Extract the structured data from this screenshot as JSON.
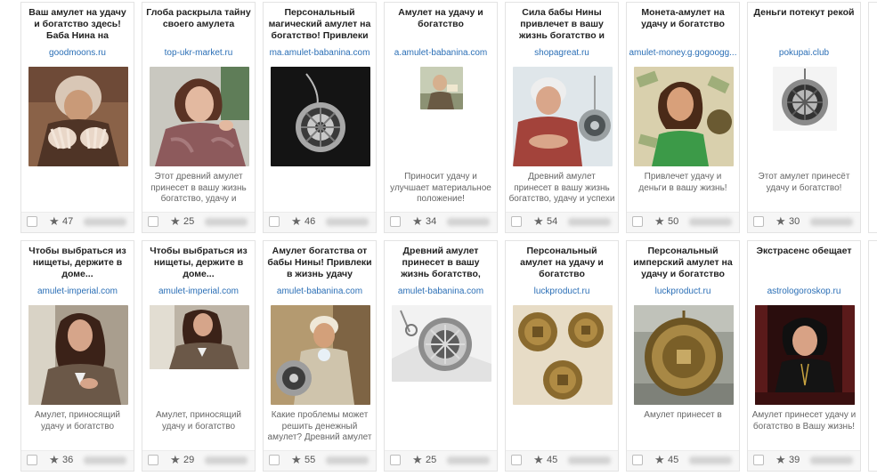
{
  "cards": [
    {
      "title": "Ваш амулет на удачу и богатство здесь! Баба Нина на рассвете",
      "domain": "goodmoons.ru",
      "description": "",
      "rating": "47",
      "image": "woman-hands-photo"
    },
    {
      "title": "Глоба раскрыла тайну своего амулета",
      "domain": "top-ukr-market.ru",
      "description": "Этот древний амулет принесет в вашу жизнь богатство, удачу и",
      "rating": "25",
      "image": "actress-photo"
    },
    {
      "title": "Персональный магический амулет на богатство! Привлеки в",
      "domain": "ma.amulet-babanina.com",
      "description": "",
      "rating": "46",
      "image": "amulet-dark-photo"
    },
    {
      "title": "Амулет на удачу и богатство",
      "domain": "a.amulet-babanina.com",
      "description": "Приносит удачу и улучшает материальное положение!",
      "rating": "34",
      "image": "small-man-photo"
    },
    {
      "title": "Сила бабы Нины привлечет в вашу жизнь богатство и",
      "domain": "shopagreat.ru",
      "description": "Древний амулет принесет в вашу жизнь богатство, удачу и успехи в любых",
      "rating": "54",
      "image": "old-woman-amulet-photo"
    },
    {
      "title": "Монета-амулет на удачу и богатство",
      "domain": "amulet-money.g.gogoogg...",
      "description": "Привлечет удачу и деньги в вашу жизнь!",
      "rating": "50",
      "image": "money-woman-photo"
    },
    {
      "title": "Деньги потекут рекой",
      "domain": "pokupai.club",
      "description": "Этот амулет принесёт удачу и богатство!",
      "rating": "30",
      "image": "amulet-white-photo"
    },
    {
      "title": "Чтобы выбраться из нищеты, держите в доме...",
      "domain": "amulet-imperial.com",
      "description": "Амулет, приносящий удачу и богатство",
      "rating": "36",
      "image": "woman-room-photo"
    },
    {
      "title": "Чтобы выбраться из нищеты, держите в доме...",
      "domain": "amulet-imperial.com",
      "description": "Амулет, приносящий удачу и богатство",
      "rating": "29",
      "image": "woman-room-photo-2"
    },
    {
      "title": "Амулет богатства от бабы Нины! Привлеки в жизнь удачу",
      "domain": "amulet-babanina.com",
      "description": "Какие проблемы может решить денежный амулет? Древний амулет принесет в",
      "rating": "55",
      "image": "old-woman-crystal-photo"
    },
    {
      "title": "Древний амулет принесет в вашу жизнь богатство,",
      "domain": "amulet-babanina.com",
      "description": "",
      "rating": "25",
      "image": "amulet-silver-photo"
    },
    {
      "title": "Персональный амулет на удачу и богатство",
      "domain": "luckproduct.ru",
      "description": "",
      "rating": "45",
      "image": "coins-photo"
    },
    {
      "title": "Персональный имперский амулет на удачу и богатство",
      "domain": "luckproduct.ru",
      "description": "Амулет принесет в",
      "rating": "45",
      "image": "gold-amulet-photo"
    },
    {
      "title": "Экстрасенс обещает",
      "domain": "astrologoroskop.ru",
      "description": "Амулет принесет удачу и богатство в Вашу жизнь!",
      "rating": "39",
      "image": "psychic-woman-photo"
    }
  ],
  "icons": {
    "star": "star-icon",
    "checkbox": "checkbox-icon"
  }
}
